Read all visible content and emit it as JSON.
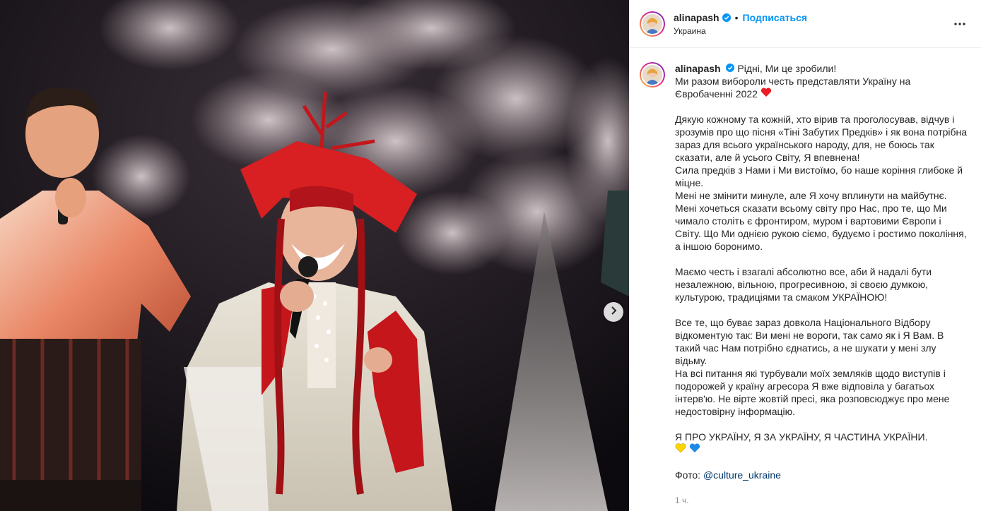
{
  "post": {
    "username": "alinapash",
    "follow_label": "Подписаться",
    "location": "Украина",
    "dot": "•"
  },
  "caption": {
    "username": "alinapash",
    "lines": {
      "l1": "Рідні, Ми це зробили!",
      "l2": "Ми разом вибороли честь представляти Україну на Євробаченні 2022",
      "l3": "Дякую кожному та кожній, хто вірив та проголосував, відчув і зрозумів про що пісня «Тіні Забутих Предків» і як вона потрібна зараз для всього українського народу, для, не боюсь так сказати, але й усього Світу, Я впевнена!",
      "l4": "Сила предків з Нами і Ми вистоїмо, бо наше коріння глибоке й міцне.",
      "l5": "Мені не змінити минуле, але Я хочу вплинути на майбутнє. Мені хочеться сказати всьому світу про Нас, про те, що Ми чимало століть є фронтиром, муром і вартовими Європи і Світу. Що Ми однією рукою сіємо, будуємо і ростимо покоління, а іншою боронимо.",
      "l6": "Маємо честь і взагалі абсолютно все, аби й надалі бути незалежною, вільною, прогресивною, зі своєю думкою, культурою, традиціями та смаком УКРАЇНОЮ!",
      "l7": "Все те, що буває зараз довкола Національного Відбору відкоментую так: Ви мені не вороги, так само як і Я Вам. В такий час Нам потрібно єднатись, а не шукати у мені злу відьму.",
      "l8": "На всі питання які турбували моїх земляків щодо виступів і подорожей у країну агресора Я вже відповіла у багатьох інтерв'ю. Не вірте жовтій пресі, яка розповсюджує про мене недостовірну інформацію.",
      "l9": "Я ПРО УКРАЇНУ, Я ЗА УКРАЇНУ, Я ЧАСТИНА УКРАЇНИ.",
      "photo_prefix": "Фото:",
      "photo_mention": "@culture_ukraine"
    },
    "time": "1 ч."
  },
  "colors": {
    "accent": "#0095f6",
    "verified": "#0095f6",
    "mention": "#00376b",
    "heart": "#ed1c24",
    "heart_yellow": "#ffd500",
    "heart_blue": "#1e88e5"
  },
  "icons": {
    "verified": "verified-badge-icon",
    "more": "more-dots-icon",
    "next": "chevron-right-icon",
    "heart_red": "red-heart-icon",
    "heart_yellow": "yellow-heart-icon",
    "heart_blue": "blue-heart-icon"
  }
}
